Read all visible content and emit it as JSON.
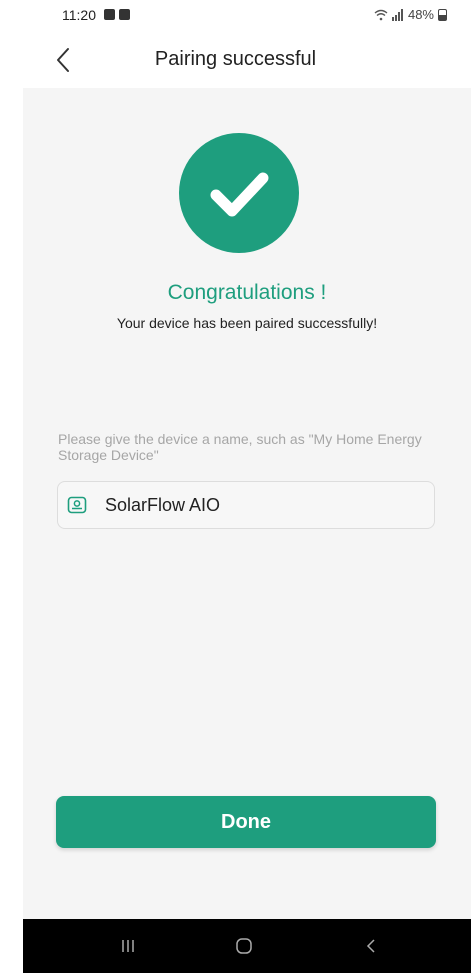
{
  "status_bar": {
    "time": "11:20",
    "battery": "48%"
  },
  "header": {
    "title": "Pairing successful"
  },
  "success": {
    "heading": "Congratulations !",
    "message": "Your device has been paired successfully!"
  },
  "device_name": {
    "hint": "Please give the device a name, such as \"My Home Energy Storage Device\"",
    "value": "SolarFlow AIO"
  },
  "actions": {
    "done_label": "Done"
  },
  "colors": {
    "accent": "#1e9e7e",
    "content_bg": "#f5f5f5",
    "hint_text": "#a6a6a6"
  },
  "icons": {
    "back": "chevron-left-icon",
    "check": "checkmark-icon",
    "device": "device-icon",
    "nav_recents": "recents-icon",
    "nav_home": "home-icon",
    "nav_back": "nav-back-icon"
  }
}
